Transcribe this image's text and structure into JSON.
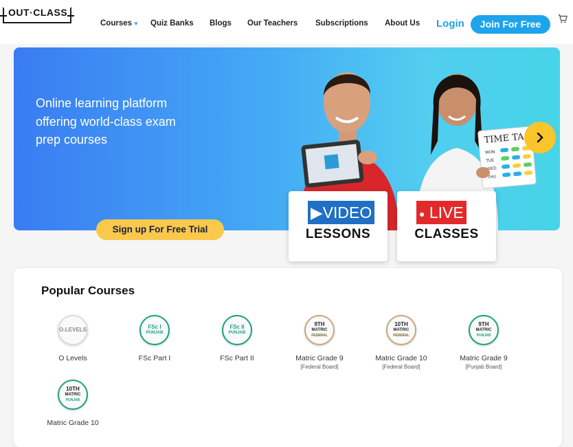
{
  "nav": {
    "logo": "OUT·CLASS",
    "items": [
      "Courses",
      "Quiz Banks",
      "Blogs",
      "Our Teachers",
      "Subscriptions",
      "About Us"
    ],
    "login": "Login",
    "join": "Join For Free"
  },
  "hero": {
    "tagline": "Online learning platform offering world-class exam prep courses",
    "signup": "Sign up For Free Trial",
    "timetable_title": "TIME TA",
    "timetable_days": [
      "MON",
      "TUE",
      "WED",
      "THU"
    ]
  },
  "promos": [
    {
      "top": "VIDEO",
      "bottom": "LESSONS",
      "color": "#1f6fc4"
    },
    {
      "top": "LIVE",
      "bottom": "CLASSES",
      "color": "#e32a2a"
    }
  ],
  "popular": {
    "title": "Popular Courses",
    "courses": [
      {
        "name": "O Levels",
        "sub": "",
        "badge": [
          "O-LEVELS"
        ],
        "color": "#8a8a8a"
      },
      {
        "name": "FSc Part I",
        "sub": "",
        "badge": [
          "FSc I",
          "PUNJAB"
        ],
        "color": "#1aa37a"
      },
      {
        "name": "FSc Part II",
        "sub": "",
        "badge": [
          "FSc II",
          "PUNJAB"
        ],
        "color": "#1aa37a"
      },
      {
        "name": "Matric Grade 9",
        "sub": "[Federal Board]",
        "badge": [
          "9TH",
          "MATRIC",
          "FEDERAL"
        ],
        "color": "#7a5a2a"
      },
      {
        "name": "Matric Grade 10",
        "sub": "[Federal Board]",
        "badge": [
          "10TH",
          "MATRIC",
          "FEDERAL"
        ],
        "color": "#7a5a2a"
      },
      {
        "name": "Matric Grade 9",
        "sub": "[Punjab Board]",
        "badge": [
          "9TH",
          "MATRIC",
          "PUNJAB"
        ],
        "color": "#1aa37a"
      },
      {
        "name": "Matric Grade 10",
        "sub": "",
        "badge": [
          "10TH",
          "MATRIC",
          "PUNJAB"
        ],
        "color": "#1aa37a"
      }
    ]
  }
}
